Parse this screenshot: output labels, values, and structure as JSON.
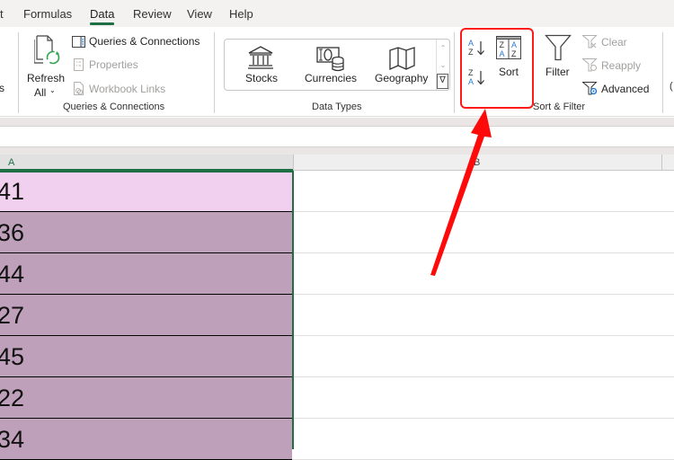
{
  "tabs": [
    {
      "label": "t",
      "active": false
    },
    {
      "label": "Formulas",
      "active": false
    },
    {
      "label": "Data",
      "active": true
    },
    {
      "label": "Review",
      "active": false
    },
    {
      "label": "View",
      "active": false
    },
    {
      "label": "Help",
      "active": false
    }
  ],
  "ribbon": {
    "partial_left_label": "s",
    "queries_group": {
      "refresh_all": {
        "line1": "Refresh",
        "line2": "All"
      },
      "queries_connections": "Queries & Connections",
      "properties": "Properties",
      "workbook_links": "Workbook Links",
      "group_label": "Queries & Connections"
    },
    "data_types_group": {
      "items": [
        {
          "label": "Stocks",
          "icon": "bank-icon"
        },
        {
          "label": "Currencies",
          "icon": "currency-coins-icon"
        },
        {
          "label": "Geography",
          "icon": "map-icon"
        }
      ],
      "group_label": "Data Types"
    },
    "sort_filter_group": {
      "sort_a_z": "A→Z",
      "sort_z_a": "Z→A",
      "sort": "Sort",
      "filter": "Filter",
      "clear": "Clear",
      "reapply": "Reapply",
      "advanced": "Advanced",
      "group_label": "Sort & Filter"
    }
  },
  "sheet": {
    "columns": [
      "A",
      "B"
    ],
    "column_a_values": [
      "41",
      "36",
      "44",
      "27",
      "45",
      "22",
      "34"
    ]
  },
  "colors": {
    "accent_green": "#1e6f44",
    "highlight_red": "#ff1a1a",
    "first_cell_fill": "#f1cfee",
    "other_cells_fill": "#bea0ba",
    "sort_icon_blue": "#2b7cd3"
  },
  "annotation": {
    "type": "arrow",
    "target": "sort-buttons",
    "color": "#ff1a1a"
  }
}
